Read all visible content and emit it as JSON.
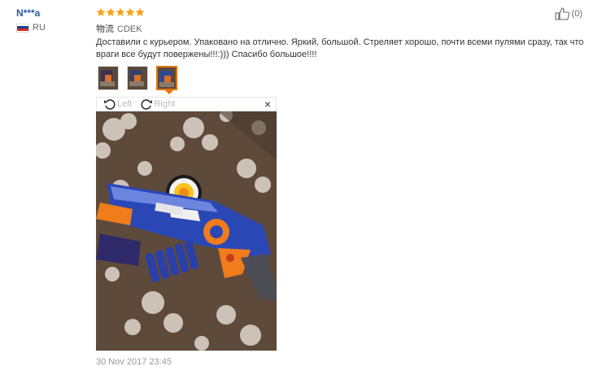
{
  "user": {
    "name": "N***a",
    "country": "RU"
  },
  "rating": {
    "stars": 5,
    "max": 5,
    "color": "#f7a21b"
  },
  "helpful": {
    "count": "(0)"
  },
  "logistics": {
    "label": "物流",
    "carrier": "CDEK"
  },
  "review": {
    "text": "Доставили с курьером. Упаковано на отлично. Яркий, большой. Стреляет хорошо, почти всеми пулями сразу, так что враги все будут повержены!!!:))) Спасибо большое!!!!"
  },
  "thumbnails": {
    "count": 3,
    "active_index": 2,
    "active_color": "#e8730c"
  },
  "viewer": {
    "left_label": "Left",
    "right_label": "Right",
    "close": "×"
  },
  "date": "30 Nov 2017 23:45"
}
